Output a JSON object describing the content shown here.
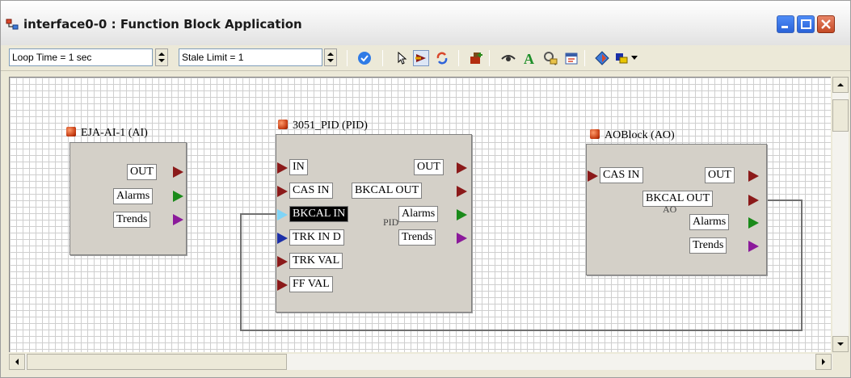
{
  "window": {
    "title": "interface0-0 : Function Block Application",
    "icon": "function-block-app-icon",
    "controls": [
      "minimize-icon",
      "maximize-icon",
      "close-icon"
    ]
  },
  "toolbar": {
    "loop_time": "Loop Time = 1 sec",
    "stale_limit": "Stale Limit = 1",
    "icons": [
      "validate-check-icon",
      "pointer-arrow-icon",
      "connect-link-icon",
      "refresh-icon",
      "add-block-icon",
      "view-eye-icon",
      "text-a-icon",
      "find-tag-icon",
      "schedule-icon",
      "diamond-tool-icon",
      "layout-color-icon",
      "dropdown-arrow-icon"
    ]
  },
  "colors": {
    "output_arrow": "#8b1a1a",
    "alarms_arrow": "#1a8a1a",
    "trends_arrow": "#8b1a9b",
    "trk_arrow": "#1c2fa8",
    "selected_arrow": "#7fd4f7"
  },
  "blocks": {
    "ai": {
      "title": "EJA-AI-1 (AI)",
      "outputs": [
        "OUT",
        "Alarms",
        "Trends"
      ]
    },
    "pid": {
      "title": "3051_PID (PID)",
      "inputs": [
        "IN",
        "CAS IN",
        "BKCAL IN",
        "TRK IN D",
        "TRK VAL",
        "FF VAL"
      ],
      "outputs": [
        "OUT",
        "BKCAL OUT",
        "Alarms",
        "Trends"
      ],
      "sub_label": "PID"
    },
    "ao": {
      "title": "AOBlock (AO)",
      "inputs": [
        "CAS IN"
      ],
      "outputs": [
        "OUT",
        "BKCAL OUT",
        "Alarms",
        "Trends"
      ],
      "sub_label": "AO"
    }
  }
}
